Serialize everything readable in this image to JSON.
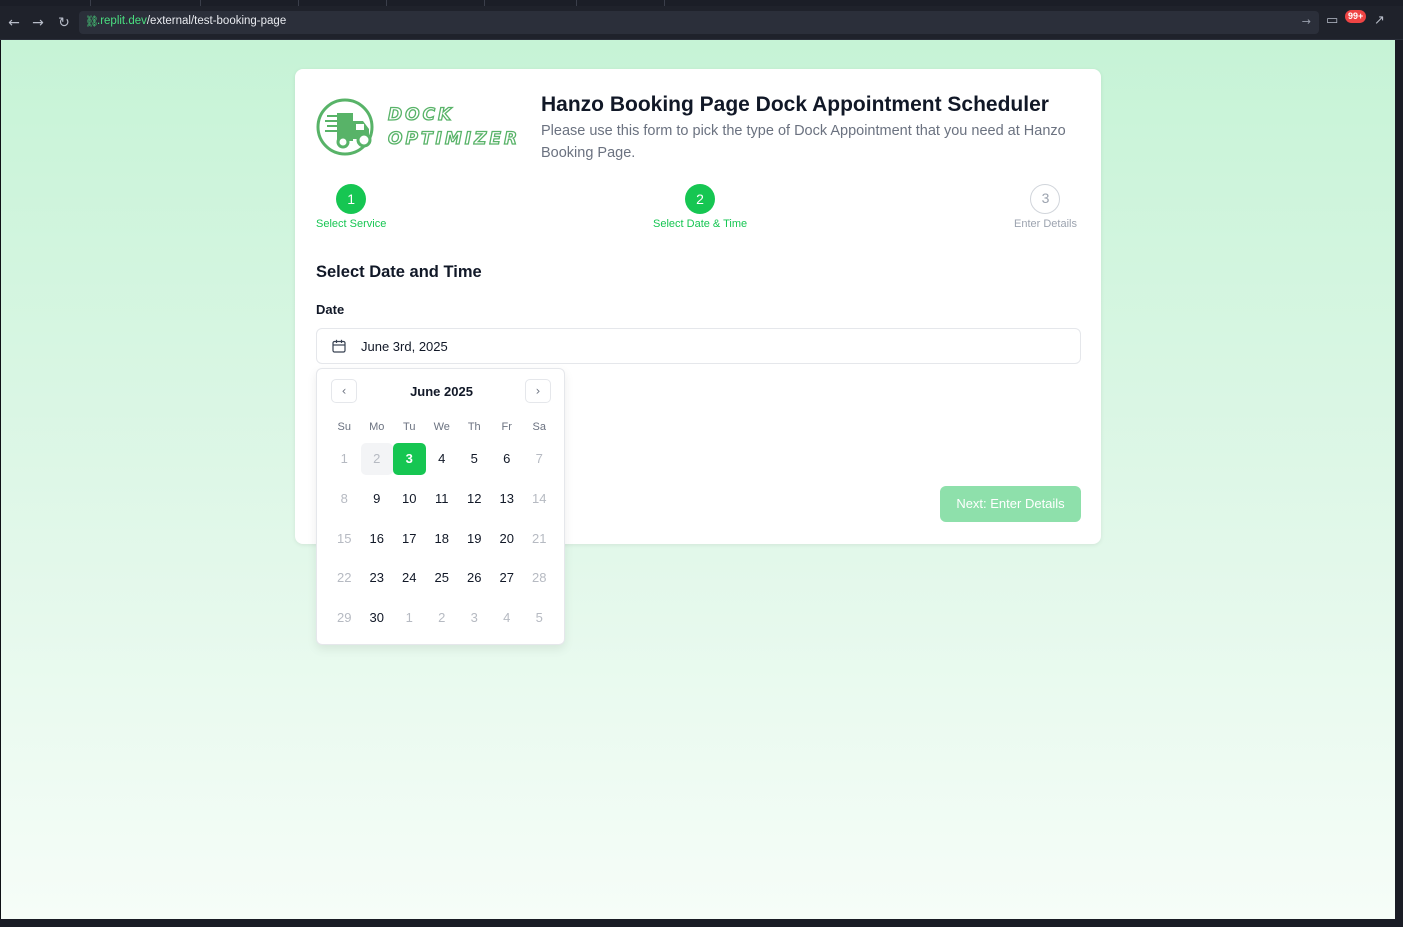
{
  "browser": {
    "url_host": ".replit.dev",
    "url_path": "/external/test-booking-page",
    "notification_badge": "99+"
  },
  "header": {
    "logo_line1": "DOCK",
    "logo_line2": "OPTIMIZER",
    "title": "Hanzo Booking Page Dock Appointment Scheduler",
    "description": "Please use this form to pick the type of Dock Appointment that you need at Hanzo Booking Page."
  },
  "steps": [
    {
      "number": "1",
      "label": "Select Service",
      "state": "complete"
    },
    {
      "number": "2",
      "label": "Select Date & Time",
      "state": "current"
    },
    {
      "number": "3",
      "label": "Enter Details",
      "state": "upcoming"
    }
  ],
  "form": {
    "section_title": "Select Date and Time",
    "date_label": "Date",
    "date_value": "June 3rd, 2025",
    "next_label": "Next: Enter Details"
  },
  "calendar": {
    "month_label": "June 2025",
    "weekdays": [
      "Su",
      "Mo",
      "Tu",
      "We",
      "Th",
      "Fr",
      "Sa"
    ],
    "weeks": [
      [
        {
          "d": "1",
          "s": "dim"
        },
        {
          "d": "2",
          "s": "today"
        },
        {
          "d": "3",
          "s": "sel"
        },
        {
          "d": "4",
          "s": "cur"
        },
        {
          "d": "5",
          "s": "cur"
        },
        {
          "d": "6",
          "s": "cur"
        },
        {
          "d": "7",
          "s": "dim"
        }
      ],
      [
        {
          "d": "8",
          "s": "dim"
        },
        {
          "d": "9",
          "s": "cur"
        },
        {
          "d": "10",
          "s": "cur"
        },
        {
          "d": "11",
          "s": "cur"
        },
        {
          "d": "12",
          "s": "cur"
        },
        {
          "d": "13",
          "s": "cur"
        },
        {
          "d": "14",
          "s": "dim"
        }
      ],
      [
        {
          "d": "15",
          "s": "dim"
        },
        {
          "d": "16",
          "s": "cur"
        },
        {
          "d": "17",
          "s": "cur"
        },
        {
          "d": "18",
          "s": "cur"
        },
        {
          "d": "19",
          "s": "cur"
        },
        {
          "d": "20",
          "s": "cur"
        },
        {
          "d": "21",
          "s": "dim"
        }
      ],
      [
        {
          "d": "22",
          "s": "dim"
        },
        {
          "d": "23",
          "s": "cur"
        },
        {
          "d": "24",
          "s": "cur"
        },
        {
          "d": "25",
          "s": "cur"
        },
        {
          "d": "26",
          "s": "cur"
        },
        {
          "d": "27",
          "s": "cur"
        },
        {
          "d": "28",
          "s": "dim"
        }
      ],
      [
        {
          "d": "29",
          "s": "dim"
        },
        {
          "d": "30",
          "s": "cur"
        },
        {
          "d": "1",
          "s": "dim"
        },
        {
          "d": "2",
          "s": "dim"
        },
        {
          "d": "3",
          "s": "dim"
        },
        {
          "d": "4",
          "s": "dim"
        },
        {
          "d": "5",
          "s": "dim"
        }
      ]
    ]
  },
  "colors": {
    "accent": "#16c652",
    "accent_light": "#8ee0ab"
  }
}
